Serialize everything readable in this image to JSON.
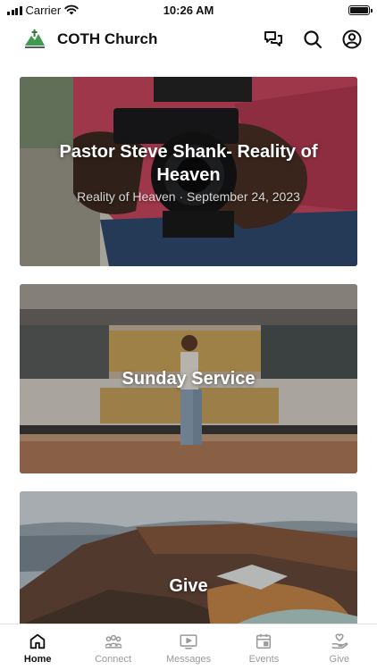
{
  "status_bar": {
    "carrier": "Carrier",
    "time": "10:26 AM"
  },
  "header": {
    "title": "COTH Church",
    "logo": "church-logo",
    "icons": [
      "chat-icon",
      "search-icon",
      "profile-icon"
    ]
  },
  "cards": [
    {
      "title": "Pastor Steve Shank- Reality of Heaven",
      "subtitle": "Reality of Heaven · September 24, 2023"
    },
    {
      "title": "Sunday Service",
      "subtitle": ""
    },
    {
      "title": "Give",
      "subtitle": ""
    }
  ],
  "tab_bar": {
    "active": "Home",
    "tabs": [
      {
        "label": "Home",
        "icon": "home-icon"
      },
      {
        "label": "Connect",
        "icon": "people-icon"
      },
      {
        "label": "Messages",
        "icon": "video-icon"
      },
      {
        "label": "Events",
        "icon": "calendar-icon"
      },
      {
        "label": "Give",
        "icon": "give-icon"
      }
    ]
  },
  "colors": {
    "accent": "#111111",
    "inactive": "#9a9a9a",
    "logo_green": "#3e9b4f"
  }
}
